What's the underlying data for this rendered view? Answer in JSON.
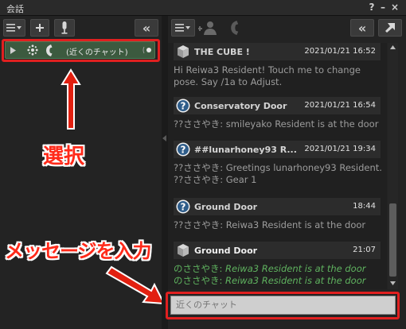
{
  "window": {
    "title": "会話",
    "help_label": "?",
    "minimize_label": "–",
    "close_label": "×"
  },
  "left_toolbar": {
    "menu_icon": "menu-icon",
    "add_icon": "plus-icon",
    "mic_icon": "microphone-icon",
    "collapse_label": "«"
  },
  "conversation_list": [
    {
      "label": "(近くのチャット)",
      "selected": true
    }
  ],
  "right_toolbar": {
    "menu_icon": "menu-icon",
    "add_user_icon": "add-user-icon",
    "call_icon": "phone-icon",
    "back_label": "«",
    "popout_icon": "arrow-up-right-icon"
  },
  "messages": [
    {
      "sender": "THE CUBE !",
      "icon": "cube-icon",
      "time": "2021/01/21 16:52",
      "lines": [
        "Hi Reiwa3 Resident! Touch me to change",
        "pose. Say /1a to Adjust."
      ]
    },
    {
      "sender": "Conservatory Door",
      "icon": "question-icon",
      "time": "2021/01/21 16:54",
      "lines": [
        "??ささやき: smileyako Resident is at the door"
      ]
    },
    {
      "sender": "##lunarhoney93 R...",
      "icon": "question-icon",
      "time": "2021/01/21 19:34",
      "lines": [
        "??ささやき: Greetings lunarhoney93 Resident.",
        "??ささやき: Gear 1"
      ]
    },
    {
      "sender": "Ground Door",
      "icon": "question-icon",
      "time": "18:44",
      "lines": [
        "??ささやき: Reiwa3 Resident is at the door"
      ]
    },
    {
      "sender": "Ground Door",
      "icon": "cube-icon",
      "time": "21:07",
      "lines": [
        {
          "prefix": "のささやき: ",
          "text": "Reiwa3 Resident is at the door"
        },
        {
          "prefix": "のささやき: ",
          "text": "Reiwa3 Resident is at the door"
        }
      ]
    }
  ],
  "input": {
    "placeholder": "近くのチャット",
    "value": ""
  },
  "annotations": {
    "select_label": "選択",
    "enter_message_label": "メッセージを入力",
    "highlight_color": "#e02020"
  },
  "colors": {
    "selected_item": "#3c5a3f",
    "green_text": "#5fb35f"
  }
}
